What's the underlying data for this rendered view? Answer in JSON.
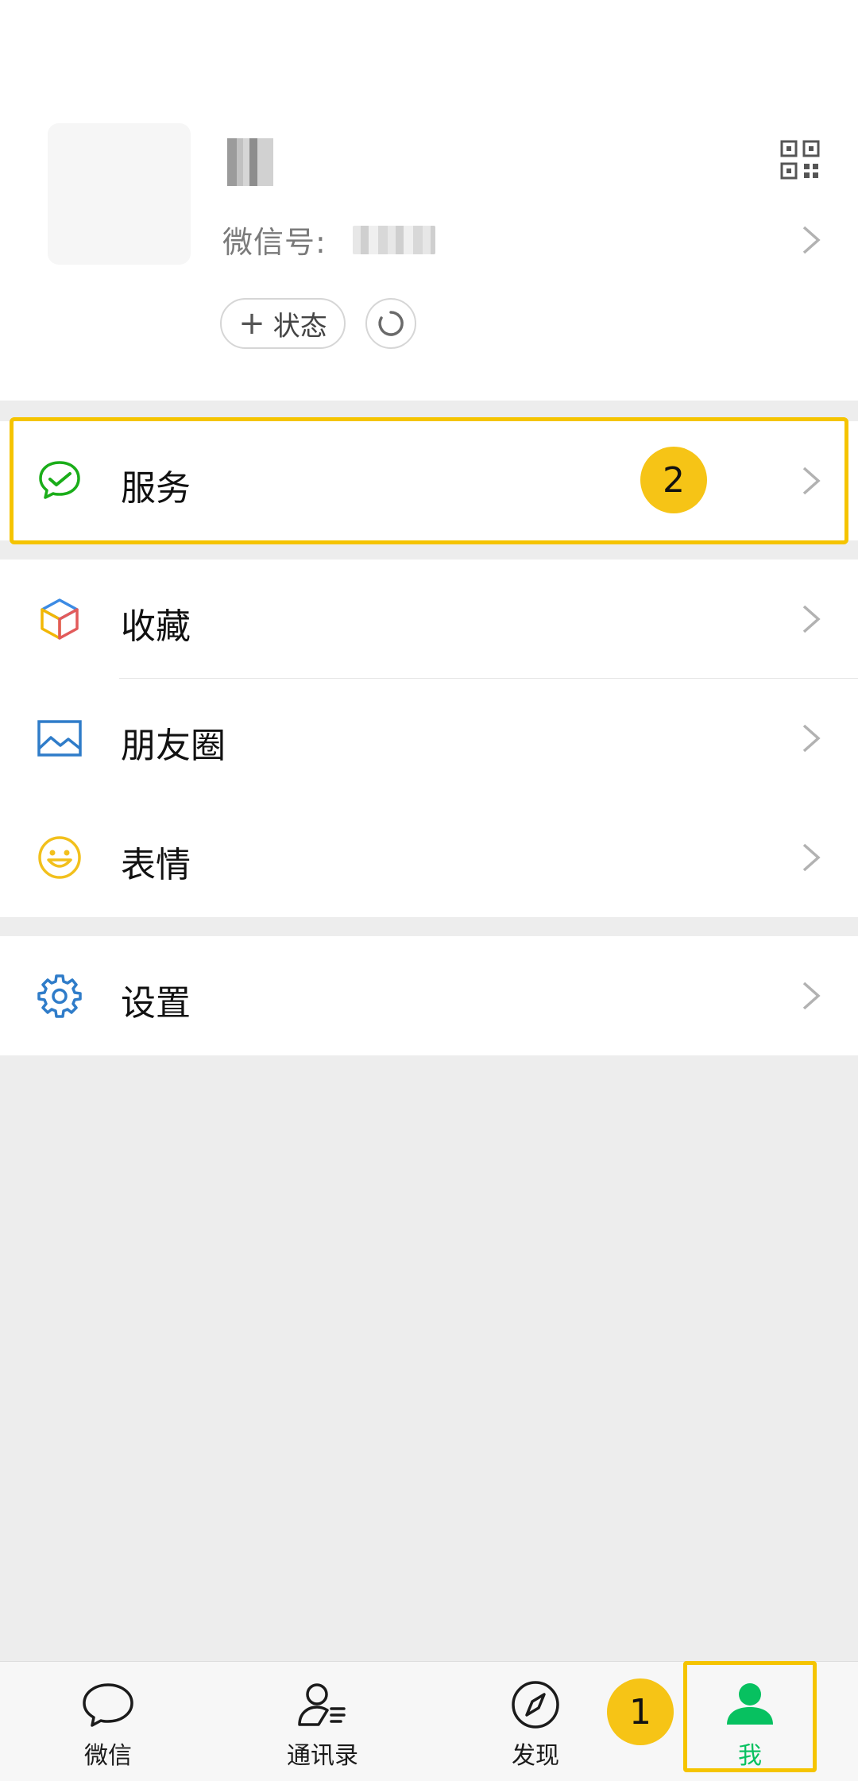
{
  "profile": {
    "wechat_id_label": "微信号:",
    "status_button_label": "状态"
  },
  "menu": {
    "service": "服务",
    "favorites": "收藏",
    "moments": "朋友圈",
    "stickers": "表情",
    "settings": "设置"
  },
  "annotations": {
    "badge_1": "1",
    "badge_2": "2",
    "highlight_color": "#f5c400"
  },
  "tabbar": {
    "tabs": [
      {
        "label": "微信",
        "icon": "chat-bubble-icon"
      },
      {
        "label": "通讯录",
        "icon": "contacts-icon"
      },
      {
        "label": "发现",
        "icon": "compass-icon"
      },
      {
        "label": "我",
        "icon": "person-icon",
        "active": true
      }
    ],
    "active_color": "#07c160"
  }
}
